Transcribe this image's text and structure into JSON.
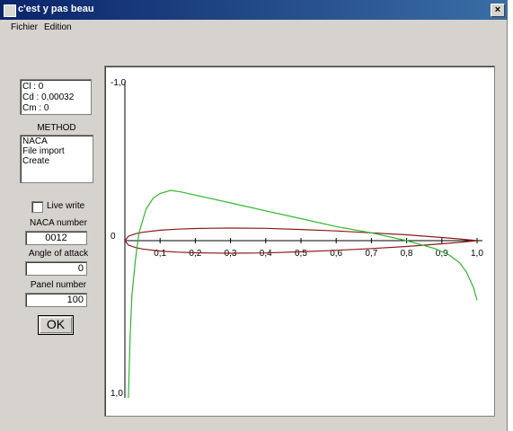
{
  "window": {
    "title": "c'est y pas beau",
    "close_glyph": "×"
  },
  "menu": [
    "Fichier",
    "Edition"
  ],
  "coefficients": [
    "Cl : 0",
    "Cd : 0,00032",
    "Cm : 0"
  ],
  "method": {
    "label": "METHOD",
    "options": [
      "NACA",
      "File import",
      "Create"
    ]
  },
  "live_write": {
    "label": "Live write",
    "checked": false
  },
  "naca": {
    "label": "NACA number",
    "value": "0012"
  },
  "attack": {
    "label": "Angle of attack",
    "value": "0"
  },
  "panel": {
    "label": "Panel number",
    "value": "100"
  },
  "ok_label": "OK",
  "chart_data": {
    "type": "line",
    "x_ticks": [
      "0",
      "0,1",
      "0,2",
      "0,3",
      "0,4",
      "0,5",
      "0,6",
      "0,7",
      "0,8",
      "0,9",
      "1,0"
    ],
    "y_top_label": "-1,0",
    "y_bottom_label": "1,0",
    "xlim": [
      0,
      1
    ],
    "ylim": [
      -1,
      1
    ],
    "series": [
      {
        "color": "#8b1a1a",
        "x": [
          0,
          0.01,
          0.03,
          0.05,
          0.1,
          0.15,
          0.2,
          0.25,
          0.3,
          0.4,
          0.5,
          0.6,
          0.7,
          0.8,
          0.9,
          0.95,
          1.0
        ],
        "y": [
          0,
          0.028,
          0.044,
          0.053,
          0.066,
          0.073,
          0.077,
          0.079,
          0.08,
          0.078,
          0.071,
          0.062,
          0.05,
          0.037,
          0.02,
          0.011,
          0
        ]
      },
      {
        "color": "#2db82d",
        "x": [
          0.01,
          0.015,
          0.02,
          0.03,
          0.04,
          0.06,
          0.08,
          0.1,
          0.13,
          0.16,
          0.2,
          0.3,
          0.4,
          0.5,
          0.6,
          0.7,
          0.8,
          0.88,
          0.92,
          0.95,
          0.97,
          0.99,
          1.0
        ],
        "y": [
          -1.0,
          -0.6,
          -0.35,
          -0.12,
          0.05,
          0.2,
          0.27,
          0.3,
          0.32,
          0.31,
          0.29,
          0.24,
          0.19,
          0.14,
          0.09,
          0.05,
          0.0,
          -0.05,
          -0.09,
          -0.14,
          -0.2,
          -0.3,
          -0.38
        ]
      }
    ]
  }
}
